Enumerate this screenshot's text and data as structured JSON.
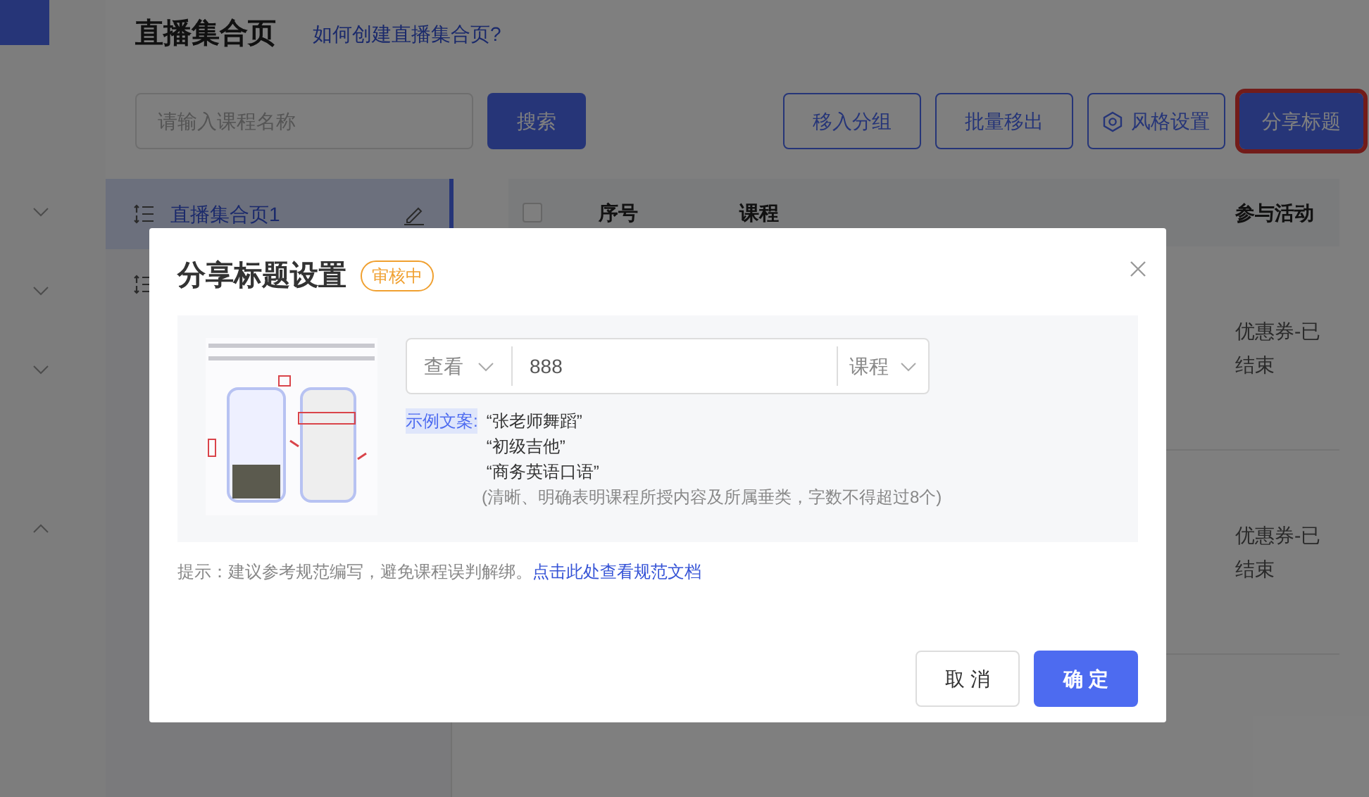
{
  "nav": [
    {
      "expanded": false
    },
    {
      "expanded": false
    },
    {
      "expanded": false
    },
    {
      "expanded": true
    }
  ],
  "page": {
    "title": "直播集合页",
    "help_link": "如何创建直播集合页?",
    "search": {
      "placeholder": "请输入课程名称"
    },
    "search_button": "搜索",
    "actions": [
      {
        "label": "移入分组",
        "kind": "outline",
        "highlighted": false
      },
      {
        "label": "批量移出",
        "kind": "outline",
        "highlighted": false
      },
      {
        "label": "风格设置",
        "kind": "icon",
        "highlighted": false
      },
      {
        "label": "分享标题",
        "kind": "primary",
        "highlighted": true
      }
    ],
    "groups": [
      {
        "label": "直播集合页1",
        "selected": true
      },
      {
        "selected": false
      }
    ],
    "table": {
      "select_all": {
        "checked": false
      },
      "columns": [
        "序号",
        "课程",
        "参与活动"
      ],
      "rows": [
        {
          "activity": "优惠券-已结束"
        },
        {
          "activity": "优惠券-已结束"
        }
      ]
    }
  },
  "dialog": {
    "title": "分享标题设置",
    "status_badge": "审核中",
    "form": {
      "prefix_select": "查看",
      "value": "888",
      "suffix_select": "课程"
    },
    "example_label": "示例文案:",
    "examples": [
      "“张老师舞蹈”",
      "“初级吉他”",
      "“商务英语口语”"
    ],
    "requirement": "(清晰、明确表明课程所授内容及所属垂类，字数不得超过8个)",
    "tip": "提示：建议参考规范编写，避免课程误判解绑。",
    "tip_link": "点击此处查看规范文档",
    "buttons": [
      {
        "label": "取 消",
        "kind": "secondary"
      },
      {
        "label": "确 定",
        "kind": "primary"
      }
    ]
  }
}
